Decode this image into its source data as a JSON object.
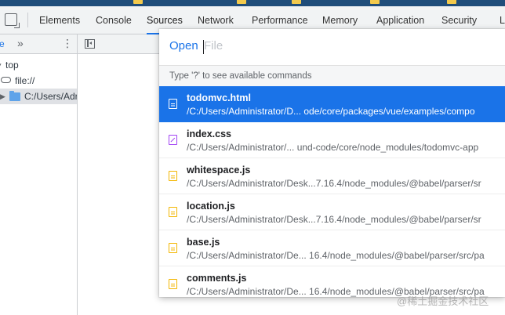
{
  "devtools": {
    "tabs": [
      {
        "label": "Elements"
      },
      {
        "label": "Console"
      },
      {
        "label": "Sources"
      },
      {
        "label": "Network"
      },
      {
        "label": "Performance"
      },
      {
        "label": "Memory"
      },
      {
        "label": "Application"
      },
      {
        "label": "Security"
      },
      {
        "label": "L"
      }
    ],
    "active_tab": "Sources",
    "accent": "#1a73e8"
  },
  "navigator": {
    "tab_label": "e",
    "more_tabs": "»",
    "tree": [
      {
        "label": "top"
      },
      {
        "label": "file://"
      },
      {
        "label": "C:/Users/Adr"
      }
    ]
  },
  "quick_open": {
    "prompt_prefix": "Open",
    "placeholder": "File",
    "hint": "Type '?' to see available commands",
    "items": [
      {
        "name": "todomvc.html",
        "path": "/C:/Users/Administrator/D...  ode/core/packages/vue/examples/compo",
        "icon": "html-file-icon",
        "selected": true
      },
      {
        "name": "index.css",
        "path": "/C:/Users/Administrator/...  und-code/core/node_modules/todomvc-app",
        "icon": "css-file-icon",
        "selected": false
      },
      {
        "name": "whitespace.js",
        "path": "/C:/Users/Administrator/Desk...7.16.4/node_modules/@babel/parser/sr",
        "icon": "js-file-icon",
        "selected": false
      },
      {
        "name": "location.js",
        "path": "/C:/Users/Administrator/Desk...7.16.4/node_modules/@babel/parser/sr",
        "icon": "js-file-icon",
        "selected": false
      },
      {
        "name": "base.js",
        "path": "/C:/Users/Administrator/De...  16.4/node_modules/@babel/parser/src/pa",
        "icon": "js-file-icon",
        "selected": false
      },
      {
        "name": "comments.js",
        "path": "/C:/Users/Administrator/De...  16.4/node_modules/@babel/parser/src/pa",
        "icon": "js-file-icon",
        "selected": false
      }
    ]
  },
  "watermark": "@稀土掘金技术社区"
}
